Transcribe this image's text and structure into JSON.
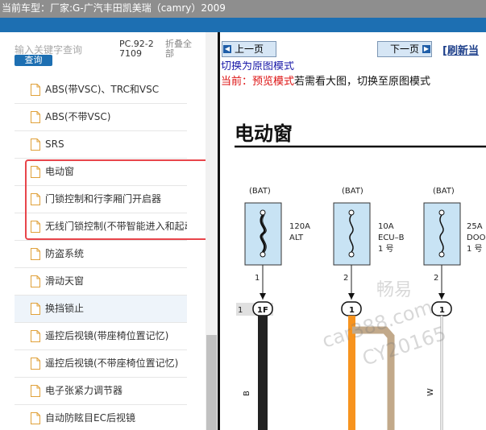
{
  "top_bar": {
    "vehicle_label": "当前车型：",
    "vehicle_value": "厂家:G-广汽丰田凯美瑞（camry）2009"
  },
  "sidebar": {
    "search_placeholder": "输入关键字查询",
    "search_button": "查询",
    "pc_code": "PC.92-27109",
    "collapse_all": "折叠全部",
    "items": [
      {
        "label": "ABS(带VSC)、TRC和VSC"
      },
      {
        "label": "ABS(不带VSC)"
      },
      {
        "label": "SRS"
      },
      {
        "label": "电动窗"
      },
      {
        "label": "门锁控制和行李厢门开启器"
      },
      {
        "label": "无线门锁控制(不带智能进入和起动"
      },
      {
        "label": "防盗系统"
      },
      {
        "label": "滑动天窗"
      },
      {
        "label": "换挡锁止"
      },
      {
        "label": "遥控后视镜(带座椅位置记忆)"
      },
      {
        "label": "遥控后视镜(不带座椅位置记忆)"
      },
      {
        "label": "电子张紧力调节器"
      },
      {
        "label": "自动防眩目EC后视镜"
      }
    ]
  },
  "content": {
    "prev_button": "上一页",
    "next_button": "下一页",
    "refresh_link": "[刷新当",
    "switch_link": "切换为原图模式",
    "mode_prefix": "当前：预览模式",
    "mode_rest": "若需看大图，切换至原图模式"
  },
  "diagram": {
    "title": "电动窗",
    "fuses": [
      {
        "bat_label": "(BAT)",
        "rating": "120A",
        "name": "ALT",
        "no": ""
      },
      {
        "bat_label": "(BAT)",
        "rating": "10A",
        "name": "ECU–B",
        "no": "1 号"
      },
      {
        "bat_label": "(BAT)",
        "rating": "25A",
        "name": "DOO",
        "no": "1 号"
      }
    ],
    "pin_2a": "2",
    "pin_2b": "2",
    "pin_1a": "1",
    "connector_1f": "1F",
    "connector_pin1": "1",
    "connector_pin2": "1",
    "connector_pin3": "1",
    "wire_b": "B",
    "wire_w": "W",
    "watermark_1": "畅易",
    "watermark_2": "car388.com",
    "watermark_3": "CY20165"
  },
  "colors": {
    "accent_blue": "#1d6fb2",
    "highlight_red": "#e8454b",
    "fuse_fill": "#c8e3f4",
    "wire_orange": "#f7931e",
    "wire_tan": "#c2a98a",
    "wire_black": "#222222"
  }
}
